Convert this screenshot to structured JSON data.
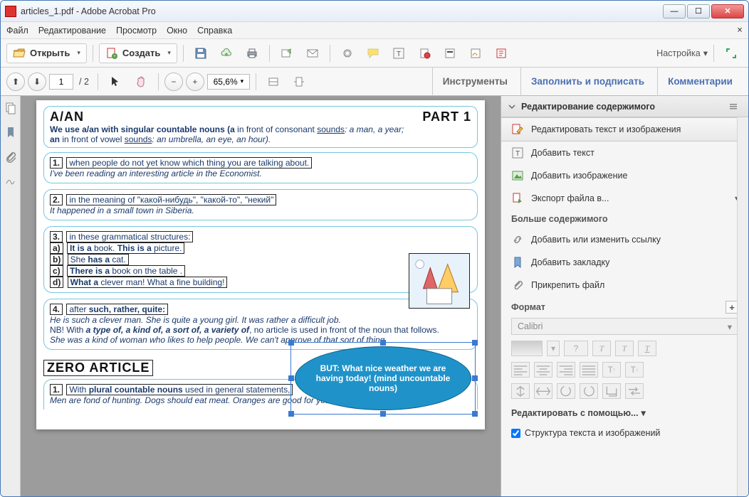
{
  "window": {
    "title": "articles_1.pdf - Adobe Acrobat Pro"
  },
  "menu": {
    "file": "Файл",
    "edit": "Редактирование",
    "view": "Просмотр",
    "window": "Окно",
    "help": "Справка"
  },
  "toolbar1": {
    "open": "Открыть",
    "create": "Создать",
    "customize": "Настройка"
  },
  "toolbar2": {
    "page_current": "1",
    "page_total": "/ 2",
    "zoom": "65,6%",
    "tab_tools": "Инструменты",
    "tab_fill": "Заполнить и подписать",
    "tab_comments": "Комментарии"
  },
  "doc": {
    "h_left": "A/AN",
    "h_right": "PART 1",
    "h_desc1_a": "We use a/an with singular countable nouns (a ",
    "h_desc1_b": "in front of consonant ",
    "h_desc1_c": "sounds",
    "h_desc1_d": ": a man, a year;",
    "h_desc2_a": "an ",
    "h_desc2_b": "in front of vowel ",
    "h_desc2_c": "sounds",
    "h_desc2_d": ": an umbrella, an eye, an hour).",
    "b1_num": "1.",
    "b1_t": "when people do not yet know which thing you are talking about.",
    "b1_i": "I've been reading an interesting article in the Economist.",
    "b2_num": "2.",
    "b2_t": "in the meaning of \"какой-нибудь\", \"какой-то\", \"некий\"",
    "b2_i": "It happened in a small town in Siberia.",
    "b3_num": "3.",
    "b3_t": "in these grammatical structures:",
    "b3_a_l": "a)",
    "b3_a_1": "It is a",
    "b3_a_2": " book. ",
    "b3_a_3": "This is a",
    "b3_a_4": " picture.",
    "b3_b_l": "b)",
    "b3_b_1": "She ",
    "b3_b_2": "has a",
    "b3_b_3": " cat.",
    "b3_c_l": "c)",
    "b3_c_1": "There is a",
    "b3_c_2": " book on the table .",
    "b3_d_l": "d)",
    "b3_d_1": "What a",
    "b3_d_2": " clever man! What a fine building!",
    "ellipse": "BUT: What nice weather we are having today! (mind uncountable nouns)",
    "b4_num": "4.",
    "b4_t1": "after ",
    "b4_t2": "such, rather, quite:",
    "b4_i1": "He is such a clever man.   She is quite a young girl.   It was rather a difficult job.",
    "b4_n1": "NB! With ",
    "b4_n2": "a type of, a kind of, a sort of, a variety of",
    "b4_n3": ", no article is used in front of the noun that follows.",
    "b4_i2": "She was a kind of woman who likes to help people.    We can't approve of that sort of thing.",
    "zero_hdr": "ZERO ARTICLE",
    "z1_num": "1.",
    "z1_t1": "With ",
    "z1_t2": "plural countable nouns",
    "z1_t3": " used in general statements,",
    "z1_i": "Men are fond of hunting.       Dogs should eat meat.       Oranges are good for you."
  },
  "panel": {
    "head": "Редактирование содержимого",
    "edit_text_img": "Редактировать текст и изображения",
    "add_text": "Добавить текст",
    "add_image": "Добавить изображение",
    "export": "Экспорт файла в...",
    "more_head": "Больше содержимого",
    "link": "Добавить или изменить ссылку",
    "bookmark": "Добавить закладку",
    "attach": "Прикрепить файл",
    "format_head": "Формат",
    "font": "Calibri",
    "help": "Редактировать с помощью...",
    "chk": "Структура текста и изображений"
  }
}
